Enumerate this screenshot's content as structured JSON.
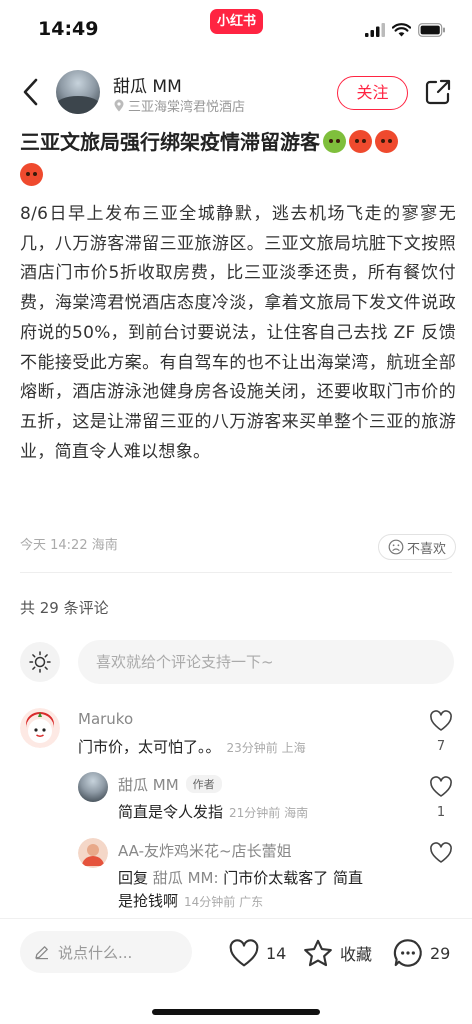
{
  "status_bar": {
    "time": "14:49",
    "brand": "小红书"
  },
  "author": {
    "name": "甜瓜 MM",
    "location": "三亚海棠湾君悦酒店",
    "follow_label": "关注"
  },
  "post": {
    "title": "三亚文旅局强行绑架疫情滞留游客",
    "body": "8/6日早上发布三亚全城静默，逃去机场飞走的寥寥无几，八万游客滞留三亚旅游区。三亚文旅局坑脏下文按照酒店门市价5折收取房费，比三亚淡季还贵，所有餐饮付费，海棠湾君悦酒店态度冷淡，拿着文旅局下发文件说政府说的50%，到前台讨要说法，让住客自己去找 ZF 反馈不能接受此方案。有自驾车的也不让出海棠湾，航班全部熔断，酒店游泳池健身房各设施关闭，还要收取门市价的五折，这是让滞留三亚的八万游客来买单整个三亚的旅游业，简直令人难以想象。",
    "meta": "今天 14:22 海南",
    "dislike_label": "不喜欢"
  },
  "comments_section": {
    "count_label": "共 29 条评论",
    "input_placeholder": "喜欢就给个评论支持一下~"
  },
  "comments": [
    {
      "author": "Maruko",
      "text": "门市价，太可怕了。。",
      "meta": "23分钟前 上海",
      "likes": "7"
    },
    {
      "author": "甜瓜 MM",
      "tag": "作者",
      "text": "简直是令人发指",
      "meta": "21分钟前 海南",
      "likes": "1"
    },
    {
      "author": "AA-友炸鸡米花~店长蕾姐",
      "reply_prefix": "回复",
      "reply_to": "甜瓜 MM:",
      "text_line1": " 门市价太载客了 简直",
      "text_line2": "是抢钱啊",
      "meta": "14分钟前 广东"
    }
  ],
  "bottom_bar": {
    "input_placeholder": "说点什么...",
    "likes": "14",
    "collect_label": "收藏",
    "comments": "29"
  },
  "colors": {
    "accent": "#ff2442"
  }
}
